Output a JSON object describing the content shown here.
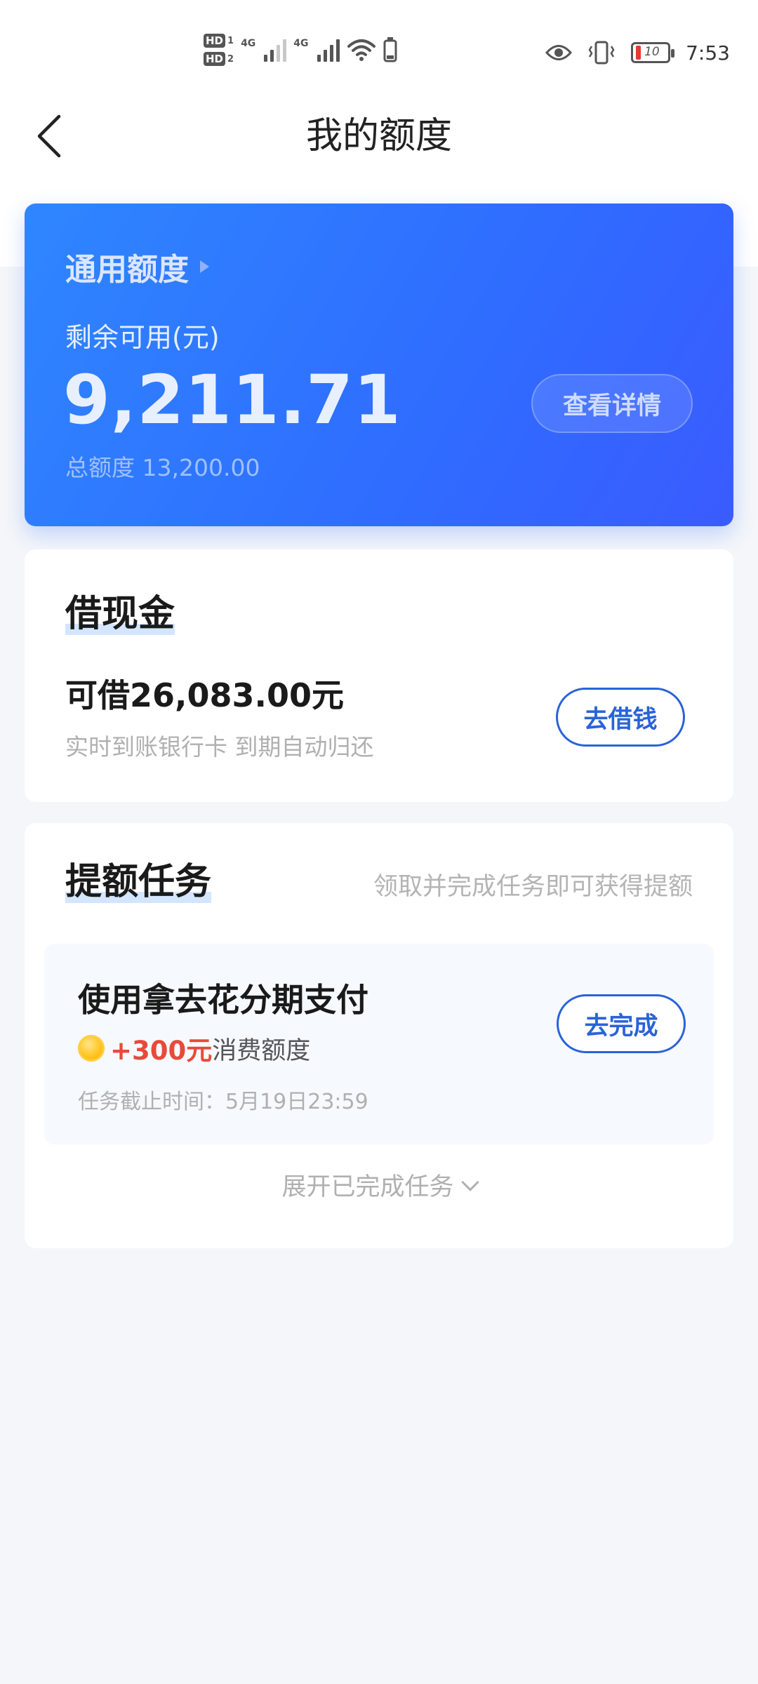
{
  "status_bar": {
    "hd1": "HD",
    "hd1_num": "1",
    "hd2": "HD",
    "hd2_num": "2",
    "net1": "4G",
    "net2": "4G",
    "battery": "10",
    "time": "7:53"
  },
  "header": {
    "title": "我的额度"
  },
  "credit_card": {
    "title": "通用额度",
    "subtitle": "剩余可用(元)",
    "available": "9,211.71",
    "total": "总额度 13,200.00",
    "detail_button": "查看详情"
  },
  "cash": {
    "title": "借现金",
    "limit": "可借26,083.00元",
    "desc": "实时到账银行卡 到期自动归还",
    "button": "去借钱"
  },
  "tasks": {
    "title": "提额任务",
    "hint": "领取并完成任务即可获得提额",
    "items": [
      {
        "name": "使用拿去花分期支付",
        "reward_amount": "+300元",
        "reward_unit": "消费额度",
        "deadline": "任务截止时间：5月19日23:59",
        "button": "去完成"
      }
    ],
    "expand": "展开已完成任务"
  }
}
